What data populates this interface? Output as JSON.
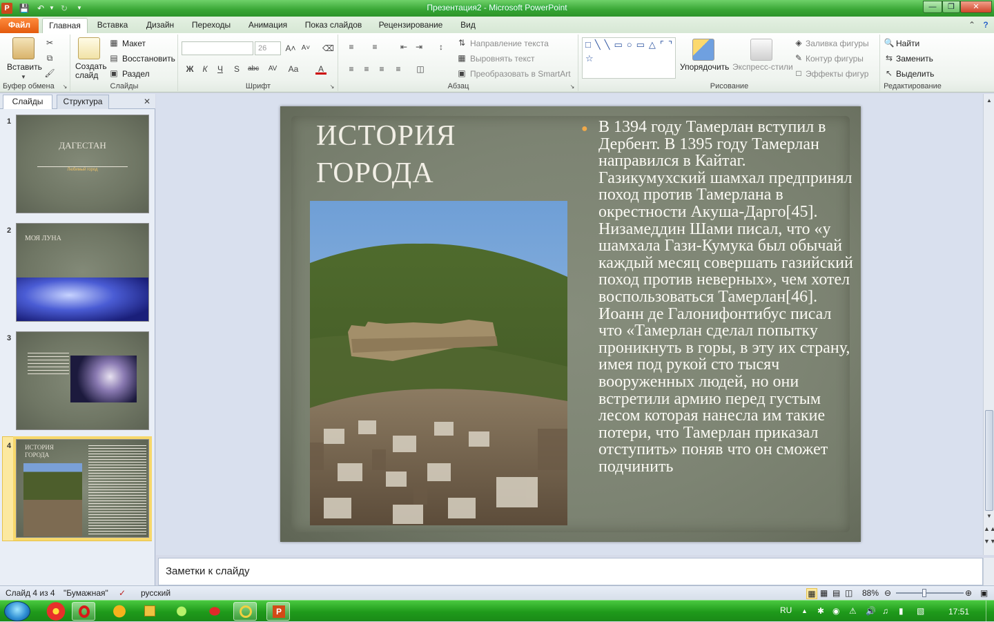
{
  "window": {
    "title": "Презентация2 - Microsoft PowerPoint"
  },
  "ribbon_tabs": [
    {
      "label": "Файл"
    },
    {
      "label": "Главная"
    },
    {
      "label": "Вставка"
    },
    {
      "label": "Дизайн"
    },
    {
      "label": "Переходы"
    },
    {
      "label": "Анимация"
    },
    {
      "label": "Показ слайдов"
    },
    {
      "label": "Рецензирование"
    },
    {
      "label": "Вид"
    }
  ],
  "ribbon": {
    "clipboard": {
      "paste": "Вставить",
      "group": "Буфер обмена"
    },
    "slides": {
      "new_slide": "Создать слайд",
      "layout": "Макет",
      "reset": "Восстановить",
      "section": "Раздел",
      "group": "Слайды"
    },
    "font": {
      "font_size": "26",
      "group": "Шрифт"
    },
    "paragraph": {
      "text_direction": "Направление текста",
      "align_text": "Выровнять текст",
      "smartart": "Преобразовать в SmartArt",
      "group": "Абзац"
    },
    "drawing": {
      "arrange": "Упорядочить",
      "quick_styles": "Экспресс-стили",
      "fill": "Заливка фигуры",
      "outline": "Контур фигуры",
      "effects": "Эффекты фигур",
      "group": "Рисование"
    },
    "editing": {
      "find": "Найти",
      "replace": "Заменить",
      "select": "Выделить",
      "group": "Редактирование"
    }
  },
  "pane_tabs": {
    "slides": "Слайды",
    "outline": "Структура"
  },
  "thumbnails": [
    {
      "num": "1",
      "title": "ДАГЕСТАН",
      "subtitle": "Любимый город"
    },
    {
      "num": "2",
      "title": "МОЯ ЛУНА"
    },
    {
      "num": "3"
    },
    {
      "num": "4",
      "title": "ИСТОРИЯ ГОРОДА"
    }
  ],
  "slide": {
    "title": "ИСТОРИЯ ГОРОДА",
    "body": "В 1394 году Тамерлан вступил в Дербент. В 1395 году Тамерлан направился в Кайтаг. Газикумухский шамхал предпринял поход против Тамерлана в окрестности Акуша-Дарго[45]. Низамеддин Шами писал, что «у шамхала Гази-Кумука был обычай каждый месяц совершать газийский поход против неверных», чем хотел воспользоваться Тамерлан[46]. Иоанн де Галонифонтибус писал что «Тамерлан сделал попытку проникнуть в горы, в эту их страну, имея под рукой сто тысяч вооруженных людей, но они встретили армию перед густым лесом которая нанесла им такие потери, что Тамерлан приказал отступить» поняв что он сможет подчинить"
  },
  "notes_placeholder": "Заметки к слайду",
  "status": {
    "slide_counter": "Слайд 4 из 4",
    "theme": "\"Бумажная\"",
    "language": "русский",
    "zoom": "88%"
  },
  "taskbar": {
    "lang": "RU",
    "clock": "17:51"
  },
  "colors": {
    "accent_green": "#38a534",
    "file_tab": "#e35a0d",
    "bullet": "#f0a94a",
    "selection": "#f7d86b"
  }
}
